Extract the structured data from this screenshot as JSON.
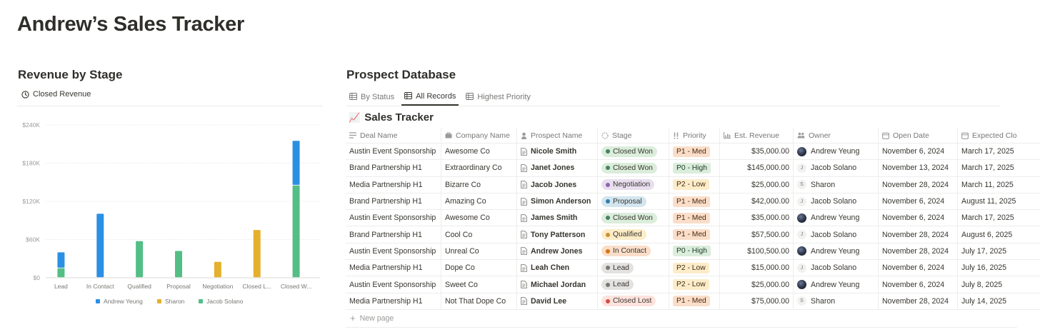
{
  "page": {
    "title": "Andrew’s Sales Tracker"
  },
  "left": {
    "heading": "Revenue by Stage",
    "chart_tab": {
      "label": "Closed Revenue",
      "icon": "clock-icon"
    }
  },
  "chart_data": {
    "type": "bar",
    "stacked": true,
    "categories": [
      "Lead",
      "In Contact",
      "Qualified",
      "Proposal",
      "Negotiation",
      "Closed L...",
      "Closed W..."
    ],
    "series": [
      {
        "name": "Andrew Yeung",
        "color": "#2b90e3",
        "values": [
          25000,
          100500,
          0,
          0,
          0,
          0,
          70000
        ]
      },
      {
        "name": "Sharon",
        "color": "#e5b02c",
        "values": [
          0,
          0,
          0,
          0,
          25000,
          75000,
          0
        ]
      },
      {
        "name": "Jacob Solano",
        "color": "#53be86",
        "values": [
          15000,
          0,
          57500,
          42000,
          0,
          0,
          145000
        ]
      }
    ],
    "y_ticks": [
      "$240K",
      "$180K",
      "$120K",
      "$60K",
      "$0"
    ],
    "ylim": [
      0,
      240000
    ],
    "grid": true,
    "legend": "bottom"
  },
  "right": {
    "heading": "Prospect Database",
    "tabs": [
      {
        "label": "By Status",
        "icon": "table-icon",
        "active": false
      },
      {
        "label": "All Records",
        "icon": "table-icon",
        "active": true
      },
      {
        "label": "Highest Priority",
        "icon": "table-icon",
        "active": false
      }
    ],
    "db_title": "Sales Tracker",
    "db_icon": "📈",
    "columns": [
      {
        "label": "Deal Name",
        "icon": "lines-icon"
      },
      {
        "label": "Company Name",
        "icon": "briefcase-icon"
      },
      {
        "label": "Prospect Name",
        "icon": "person-icon"
      },
      {
        "label": "Stage",
        "icon": "status-icon"
      },
      {
        "label": "Priority",
        "icon": "exclamation-icon"
      },
      {
        "label": "Est. Revenue",
        "icon": "chart-icon"
      },
      {
        "label": "Owner",
        "icon": "people-icon"
      },
      {
        "label": "Open Date",
        "icon": "calendar-icon"
      },
      {
        "label": "Expected Clo",
        "icon": "calendar-icon"
      }
    ],
    "rows": [
      {
        "deal": "Austin Event Sponsorship",
        "company": "Awesome Co",
        "prospect": "Nicole Smith",
        "stage": "Closed Won",
        "priority": "P1 - Med",
        "revenue": "$35,000.00",
        "owner": "Andrew Yeung",
        "open": "November 6, 2024",
        "close": "March 17, 2025"
      },
      {
        "deal": "Brand Partnership H1",
        "company": "Extraordinary Co",
        "prospect": "Janet Jones",
        "stage": "Closed Won",
        "priority": "P0 - High",
        "revenue": "$145,000.00",
        "owner": "Jacob Solano",
        "open": "November 13, 2024",
        "close": "March 17, 2025"
      },
      {
        "deal": "Media Partnership H1",
        "company": "Bizarre Co",
        "prospect": "Jacob Jones",
        "stage": "Negotiation",
        "priority": "P2 - Low",
        "revenue": "$25,000.00",
        "owner": "Sharon",
        "open": "November 28, 2024",
        "close": "March 11, 2025"
      },
      {
        "deal": "Brand Partnership H1",
        "company": "Amazing Co",
        "prospect": "Simon Anderson",
        "stage": "Proposal",
        "priority": "P1 - Med",
        "revenue": "$42,000.00",
        "owner": "Jacob Solano",
        "open": "November 6, 2024",
        "close": "August 11, 2025"
      },
      {
        "deal": "Austin Event Sponsorship",
        "company": "Awesome Co",
        "prospect": "James Smith",
        "stage": "Closed Won",
        "priority": "P1 - Med",
        "revenue": "$35,000.00",
        "owner": "Andrew Yeung",
        "open": "November 6, 2024",
        "close": "March 17, 2025"
      },
      {
        "deal": "Brand Partnership H1",
        "company": "Cool Co",
        "prospect": "Tony Patterson",
        "stage": "Qualified",
        "priority": "P1 - Med",
        "revenue": "$57,500.00",
        "owner": "Jacob Solano",
        "open": "November 28, 2024",
        "close": "August 6, 2025"
      },
      {
        "deal": "Austin Event Sponsorship",
        "company": "Unreal Co",
        "prospect": "Andrew Jones",
        "stage": "In Contact",
        "priority": "P0 - High",
        "revenue": "$100,500.00",
        "owner": "Andrew Yeung",
        "open": "November 28, 2024",
        "close": "July 17, 2025"
      },
      {
        "deal": "Media Partnership H1",
        "company": "Dope Co",
        "prospect": "Leah Chen",
        "stage": "Lead",
        "priority": "P2 - Low",
        "revenue": "$15,000.00",
        "owner": "Jacob Solano",
        "open": "November 6, 2024",
        "close": "July 16, 2025"
      },
      {
        "deal": "Austin Event Sponsorship",
        "company": "Sweet Co",
        "prospect": "Michael Jordan",
        "stage": "Lead",
        "priority": "P2 - Low",
        "revenue": "$25,000.00",
        "owner": "Andrew Yeung",
        "open": "November 6, 2024",
        "close": "July 8, 2025"
      },
      {
        "deal": "Media Partnership H1",
        "company": "Not That Dope Co",
        "prospect": "David Lee",
        "stage": "Closed Lost",
        "priority": "P1 - Med",
        "revenue": "$75,000.00",
        "owner": "Sharon",
        "open": "November 28, 2024",
        "close": "July 14, 2025"
      }
    ],
    "new_page_label": "New page",
    "stage_colors": {
      "Closed Won": {
        "bg": "#dbeddb",
        "dot": "#448361"
      },
      "Negotiation": {
        "bg": "#e8deee",
        "dot": "#9065b0"
      },
      "Proposal": {
        "bg": "#d3e5ef",
        "dot": "#337ea9"
      },
      "Qualified": {
        "bg": "#fdecc8",
        "dot": "#cb912f"
      },
      "In Contact": {
        "bg": "#fadec9",
        "dot": "#d9730d"
      },
      "Lead": {
        "bg": "#e3e2e0",
        "dot": "#787774"
      },
      "Closed Lost": {
        "bg": "#ffe2dd",
        "dot": "#d44c47"
      }
    },
    "priority_colors": {
      "P0 - High": {
        "bg": "#dbeddb",
        "fg": "#1c3829"
      },
      "P1 - Med": {
        "bg": "#fadec9",
        "fg": "#49290e"
      },
      "P2 - Low": {
        "bg": "#fdecc8",
        "fg": "#402c1b"
      }
    },
    "owner_avatars": {
      "Andrew Yeung": "",
      "Jacob Solano": "J",
      "Sharon": "S"
    }
  }
}
